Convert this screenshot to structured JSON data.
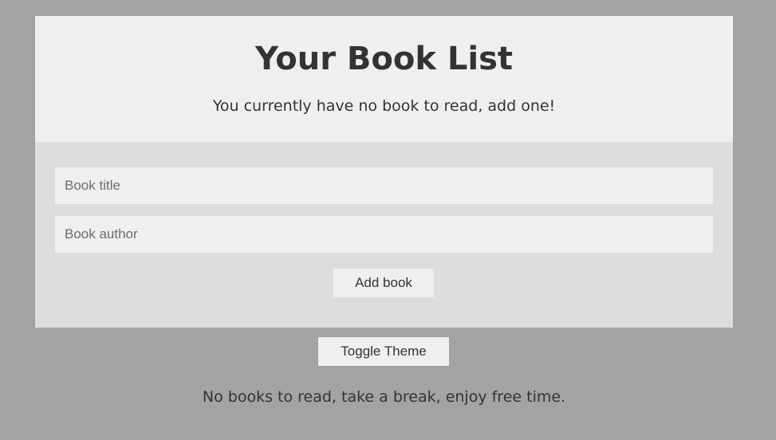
{
  "header": {
    "title": "Your Book List",
    "subtitle": "You currently have no book to read, add one!"
  },
  "form": {
    "title_placeholder": "Book title",
    "title_value": "",
    "author_placeholder": "Book author",
    "author_value": "",
    "add_label": "Add book"
  },
  "toggle_label": "Toggle Theme",
  "footer_message": "No books to read, take a break, enjoy free time.",
  "colors": {
    "page_background": "#a3a3a3",
    "card_background": "#dddddd",
    "header_background": "#efefef",
    "text": "#333333"
  }
}
